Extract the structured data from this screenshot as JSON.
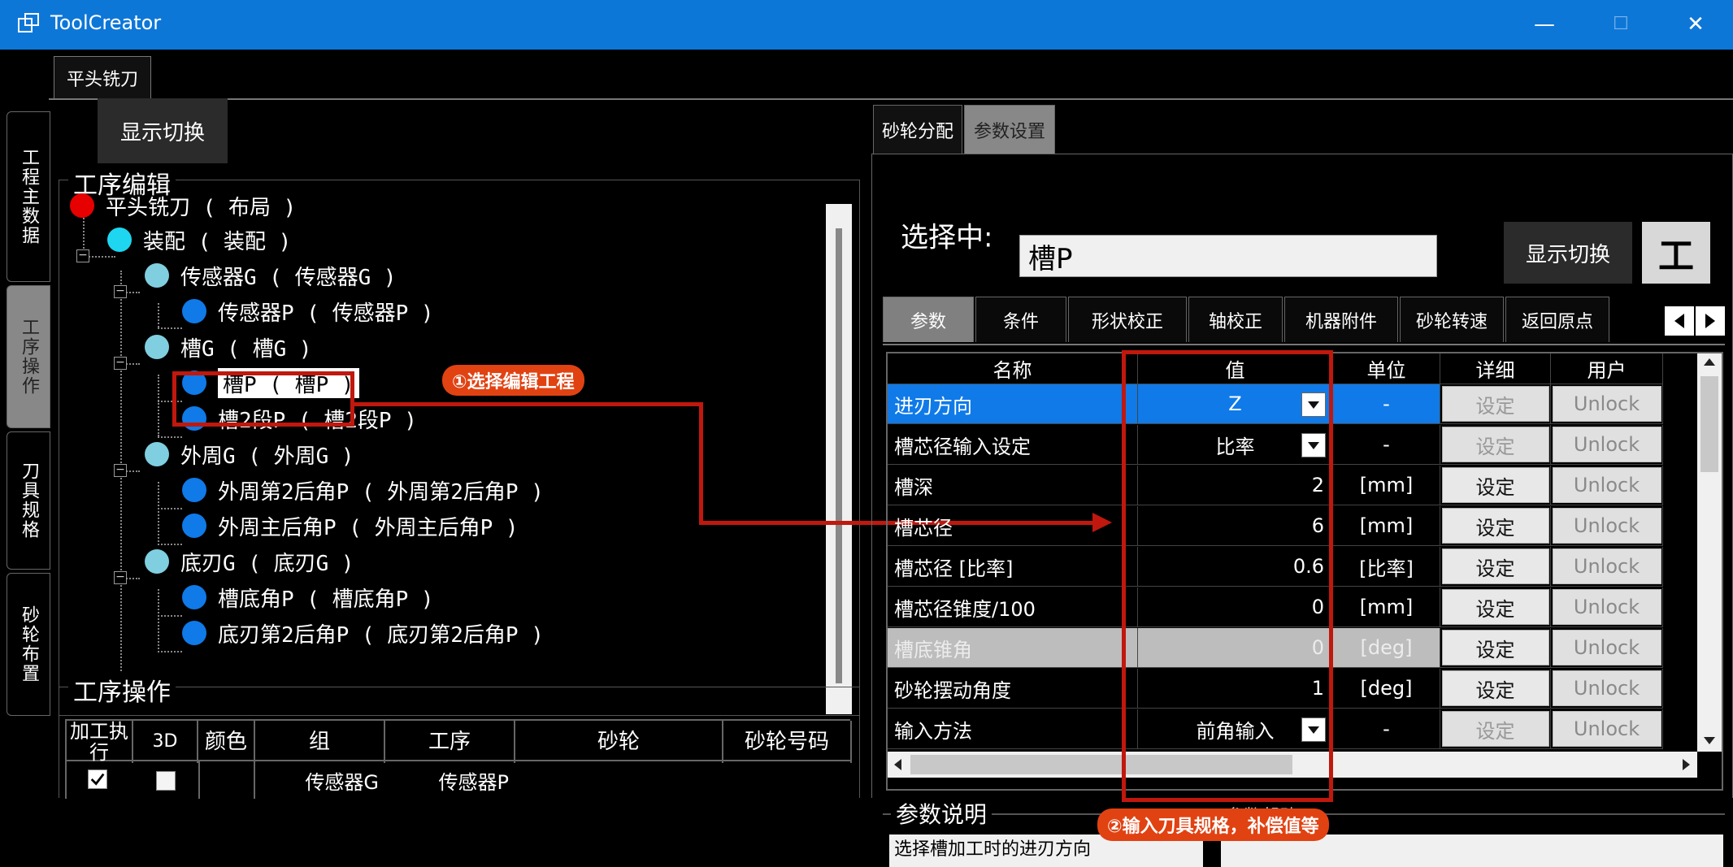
{
  "window": {
    "title": "ToolCreator",
    "minimize": "—",
    "maximize": "☐",
    "close": "✕"
  },
  "top_tab": "平头铣刀",
  "side_tabs": [
    "工程主数据",
    "工序操作",
    "刀具规格",
    "砂轮布置"
  ],
  "left": {
    "toggle_button": "显示切换",
    "process_edit_label": "工序编辑",
    "tree": [
      {
        "text": "平头铣刀 ( 布局 )",
        "color": "#e60000"
      },
      {
        "text": "装配 ( 装配 )",
        "color": "#1ed6ef"
      },
      {
        "text": "传感器G ( 传感器G )",
        "color": "#7fcfe0"
      },
      {
        "text": "传感器P ( 传感器P )",
        "color": "#0f7ae8"
      },
      {
        "text": "槽G ( 槽G )",
        "color": "#7fcfe0"
      },
      {
        "text": "槽P ( 槽P )",
        "color": "#0f7ae8"
      },
      {
        "text": "槽2段P ( 槽2段P )",
        "color": "#0f7ae8"
      },
      {
        "text": "外周G ( 外周G )",
        "color": "#7fcfe0"
      },
      {
        "text": "外周第2后角P ( 外周第2后角P )",
        "color": "#0f7ae8"
      },
      {
        "text": "外周主后角P ( 外周主后角P )",
        "color": "#0f7ae8"
      },
      {
        "text": "底刃G ( 底刃G )",
        "color": "#7fcfe0"
      },
      {
        "text": "槽底角P ( 槽底角P )",
        "color": "#0f7ae8"
      },
      {
        "text": "底刃第2后角P ( 底刃第2后角P )",
        "color": "#0f7ae8"
      }
    ],
    "process_op_label": "工序操作",
    "op_table": {
      "headers": [
        "加工执行",
        "3D",
        "颜色",
        "组",
        "工序",
        "砂轮",
        "砂轮号码"
      ],
      "rows": [
        {
          "group": "传感器G",
          "process": "传感器P"
        }
      ]
    }
  },
  "right": {
    "tabs": [
      "砂轮分配",
      "参数设置"
    ],
    "selected_label": "选择中:",
    "selected_value": "槽P",
    "toggle_button": "显示切换",
    "icon_button": "工",
    "param_tabs": [
      "参数",
      "条件",
      "形状校正",
      "轴校正",
      "机器附件",
      "砂轮转速",
      "返回原点"
    ],
    "grid_headers": [
      "名称",
      "值",
      "单位",
      "详细",
      "用户"
    ],
    "grid_rows": [
      {
        "name": "进刃方向",
        "value": "Z",
        "unit": "-",
        "detail": "设定",
        "user": "Unlock"
      },
      {
        "name": "槽芯径输入设定",
        "value": "比率",
        "unit": "-",
        "detail": "设定",
        "user": "Unlock"
      },
      {
        "name": "槽深",
        "value": "2",
        "unit": "[mm]",
        "detail": "设定",
        "user": "Unlock"
      },
      {
        "name": "槽芯径",
        "value": "6",
        "unit": "[mm]",
        "detail": "设定",
        "user": "Unlock"
      },
      {
        "name": "槽芯径 [比率]",
        "value": "0.6",
        "unit": "[比率]",
        "detail": "设定",
        "user": "Unlock"
      },
      {
        "name": "槽芯径锥度/100",
        "value": "0",
        "unit": "[mm]",
        "detail": "设定",
        "user": "Unlock"
      },
      {
        "name": "槽底锥角",
        "value": "0",
        "unit": "[deg]",
        "detail": "设定",
        "user": "Unlock"
      },
      {
        "name": "砂轮摆动角度",
        "value": "1",
        "unit": "[deg]",
        "detail": "设定",
        "user": "Unlock"
      },
      {
        "name": "输入方法",
        "value": "前角输入",
        "unit": "-",
        "detail": "设定",
        "user": "Unlock"
      }
    ],
    "desc_label": "参数说明",
    "desc_text": "选择槽加工时的进刃方向",
    "desc_right": "参数帮助"
  },
  "annotations": {
    "callout1": "①选择编辑工程",
    "callout2": "②输入刀具规格，补偿值等"
  }
}
